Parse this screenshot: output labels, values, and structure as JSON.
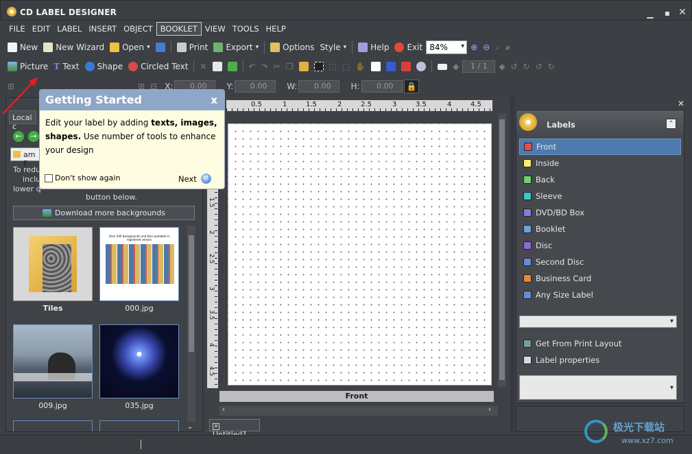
{
  "app": {
    "title": "CD LABEL DESIGNER"
  },
  "menu": [
    "FILE",
    "EDIT",
    "LABEL",
    "INSERT",
    "OBJECT",
    "BOOKLET",
    "VIEW",
    "TOOLS",
    "HELP"
  ],
  "menu_active": "BOOKLET",
  "toolbar1": {
    "new": "New",
    "wizard": "New Wizard",
    "open": "Open",
    "print": "Print",
    "export": "Export",
    "options": "Options",
    "style": "Style",
    "help": "Help",
    "exit": "Exit",
    "zoom": "84%"
  },
  "toolbar2": {
    "picture": "Picture",
    "text": "Text",
    "shape": "Shape",
    "circled_text": "Circled Text",
    "page": "1 / 1"
  },
  "toolbar3": {
    "x_label": "X:",
    "y_label": "Y:",
    "w_label": "W:",
    "h_label": "H:",
    "x": "0.00",
    "y": "0.00",
    "w": "0.00",
    "h": "0.00"
  },
  "tooltip": {
    "title": "Getting Started",
    "close": "x",
    "text_a": "Edit your label by adding ",
    "text_b": "texts, images, shapes.",
    "text_c": " Use number of tools to enhance your design",
    "dont_show": "Don't show again",
    "next": "Next"
  },
  "left_panel": {
    "tab": "Local c",
    "folder": "am F",
    "info_a": "To redu",
    "info_b": "inclu",
    "info_c": "lower q",
    "info_d": "button below.",
    "download": "Download more backgrounds",
    "thumbs": [
      {
        "name": "Tiles"
      },
      {
        "name": "000.jpg",
        "text": "Over 240 backgrounds and tiles available in registered version"
      },
      {
        "name": "009.jpg"
      },
      {
        "name": "035.jpg"
      }
    ]
  },
  "ruler": {
    "top": [
      "0.5",
      "1",
      "1.5",
      "2",
      "2.5",
      "3",
      "3.5",
      "4",
      "4.5"
    ],
    "left": [
      "1.5",
      "2",
      "2.5",
      "3",
      "3.5",
      "4",
      "4.5"
    ]
  },
  "canvas": {
    "label": "Front",
    "doc_tab": "Untitled1"
  },
  "labels_panel": {
    "title": "Labels",
    "items": [
      {
        "name": "Front",
        "color": "#e05050"
      },
      {
        "name": "Inside",
        "color": "#f5f06a"
      },
      {
        "name": "Back",
        "color": "#6fd36f"
      },
      {
        "name": "Sleeve",
        "color": "#3ec7c7"
      },
      {
        "name": "DVD/BD Box",
        "color": "#8c7ad8"
      },
      {
        "name": "Booklet",
        "color": "#6fa0e0"
      },
      {
        "name": "Disc",
        "color": "#8c6ad8"
      },
      {
        "name": "Second Disc",
        "color": "#6a8ad8"
      },
      {
        "name": "Business Card",
        "color": "#e08a3a"
      },
      {
        "name": "Any Size Label",
        "color": "#6a8ad8"
      }
    ],
    "get_layout": "Get From Print Layout",
    "properties": "Label properties"
  },
  "watermark": {
    "text_cn": "极光下载站",
    "url": "www.xz7.com"
  }
}
